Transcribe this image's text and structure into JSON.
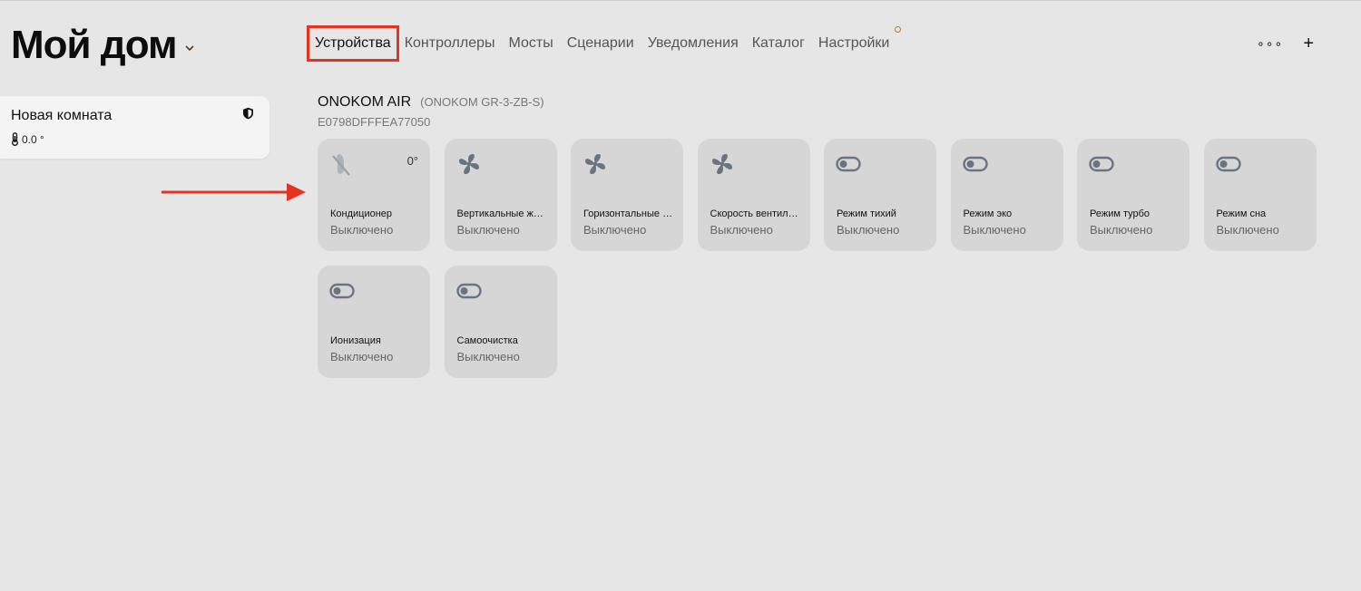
{
  "header": {
    "home_title": "Мой дом"
  },
  "tabs": [
    {
      "label": "Устройства",
      "active": true
    },
    {
      "label": "Контроллеры"
    },
    {
      "label": "Мосты"
    },
    {
      "label": "Сценарии"
    },
    {
      "label": "Уведомления"
    },
    {
      "label": "Каталог"
    },
    {
      "label": "Настройки",
      "has_dot": true
    }
  ],
  "actions": {
    "more": "∘∘∘",
    "add": "+"
  },
  "room": {
    "name": "Новая комната",
    "temperature": "0.0 °"
  },
  "device": {
    "name": "ONOKOM AIR",
    "model": "(ONOKOM GR-3-ZB-S)",
    "id": "E0798DFFFEA77050"
  },
  "tiles": [
    {
      "icon": "ac-off-icon",
      "name": "Кондиционер",
      "state": "Выключено",
      "value": "0°"
    },
    {
      "icon": "fan-icon",
      "name": "Вертикальные жалюзи",
      "state": "Выключено"
    },
    {
      "icon": "fan-icon",
      "name": "Горизонтальные жалюзи",
      "state": "Выключено"
    },
    {
      "icon": "fan-icon",
      "name": "Скорость вентилятора",
      "state": "Выключено"
    },
    {
      "icon": "toggle-icon",
      "name": "Режим тихий",
      "state": "Выключено"
    },
    {
      "icon": "toggle-icon",
      "name": "Режим эко",
      "state": "Выключено"
    },
    {
      "icon": "toggle-icon",
      "name": "Режим турбо",
      "state": "Выключено"
    },
    {
      "icon": "toggle-icon",
      "name": "Режим сна",
      "state": "Выключено"
    },
    {
      "icon": "toggle-icon",
      "name": "Ионизация",
      "state": "Выключено"
    },
    {
      "icon": "toggle-icon",
      "name": "Самоочистка",
      "state": "Выключено"
    }
  ],
  "colors": {
    "highlight": "#e8321f",
    "tile_bg": "#d6d6d6",
    "icon": "#6b7280"
  }
}
